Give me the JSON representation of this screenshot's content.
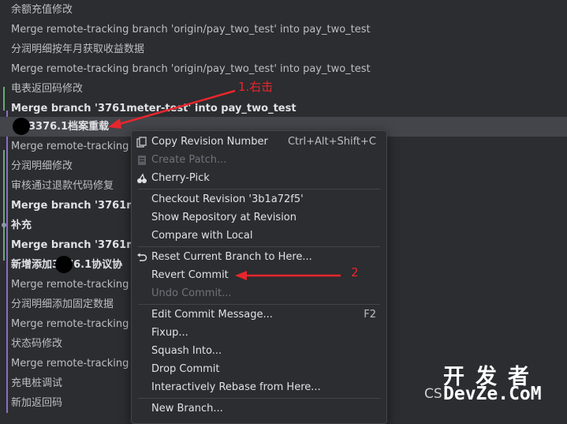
{
  "commits": [
    {
      "message": "余额充值修改",
      "bold": false
    },
    {
      "message": "Merge remote-tracking branch 'origin/pay_two_test' into pay_two_test",
      "bold": false
    },
    {
      "message": "分润明细按年月获取收益数据",
      "bold": false
    },
    {
      "message": "Merge remote-tracking branch 'origin/pay_two_test' into pay_two_test",
      "bold": false
    },
    {
      "message": "电表返回码修改",
      "bold": false
    },
    {
      "message": "Merge branch '3761meter-test' into pay_two_test",
      "bold": true
    },
    {
      "message": "3376.1档案重载",
      "bold": true,
      "selected": true
    },
    {
      "message": "Merge remote-tracking b",
      "bold": false
    },
    {
      "message": "分润明细修改",
      "bold": false
    },
    {
      "message": "审核通过退款代码修复",
      "bold": false
    },
    {
      "message": "Merge branch '3761me",
      "bold": true
    },
    {
      "message": "补充",
      "bold": true
    },
    {
      "message": "Merge branch '3761me",
      "bold": true
    },
    {
      "message": "新增添加3376.1协议协",
      "bold": true
    },
    {
      "message": "Merge remote-tracking b",
      "bold": false
    },
    {
      "message": "分润明细添加固定数据",
      "bold": false
    },
    {
      "message": "Merge remote-tracking b",
      "bold": false
    },
    {
      "message": "状态码修改",
      "bold": false
    },
    {
      "message": "Merge remote-tracking b",
      "bold": false
    },
    {
      "message": "充电桩调试",
      "bold": false
    },
    {
      "message": "新加返回码",
      "bold": false
    }
  ],
  "context_menu": {
    "copy_revision": {
      "label": "Copy Revision Number",
      "shortcut": "Ctrl+Alt+Shift+C"
    },
    "create_patch": {
      "label": "Create Patch..."
    },
    "cherry_pick": {
      "label": "Cherry-Pick"
    },
    "checkout_revision": {
      "label": "Checkout Revision '3b1a72f5'"
    },
    "show_repository": {
      "label": "Show Repository at Revision"
    },
    "compare_local": {
      "label": "Compare with Local"
    },
    "reset_branch": {
      "label": "Reset Current Branch to Here..."
    },
    "revert_commit": {
      "label": "Revert Commit"
    },
    "undo_commit": {
      "label": "Undo Commit..."
    },
    "edit_message": {
      "label": "Edit Commit Message...",
      "shortcut": "F2"
    },
    "fixup": {
      "label": "Fixup..."
    },
    "squash": {
      "label": "Squash Into..."
    },
    "drop": {
      "label": "Drop Commit"
    },
    "rebase": {
      "label": "Interactively Rebase from Here..."
    },
    "new_branch": {
      "label": "New Branch..."
    }
  },
  "annotations": {
    "step1": "1.右击",
    "step2": "2",
    "color": "#e8262d"
  },
  "watermark": {
    "top": "开发者",
    "bottom": "DevZe.CoM",
    "prefix": "CS"
  },
  "colors": {
    "background": "#2b2d30",
    "selected_row": "#43454a",
    "graph_green": "#6aab73",
    "graph_purple": "#8e6bc7"
  }
}
